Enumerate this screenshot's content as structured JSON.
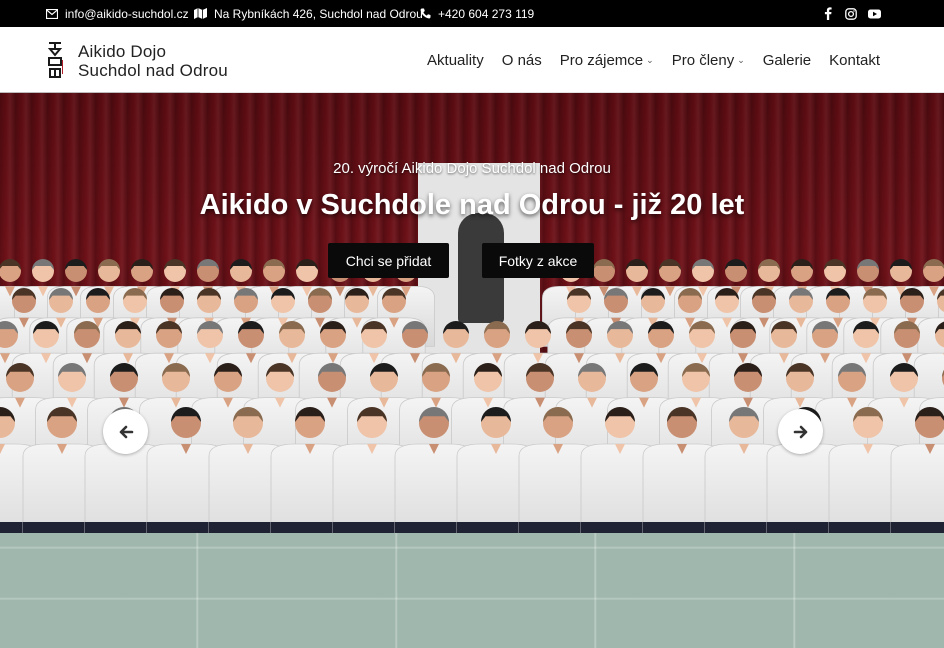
{
  "topbar": {
    "email": "info@aikido-suchdol.cz",
    "address": "Na Rybníkách 426, Suchdol nad Odrou",
    "phone": "+420 604 273 119",
    "social": [
      {
        "icon": "facebook-icon",
        "glyph": "f"
      },
      {
        "icon": "instagram-icon",
        "glyph": "◎"
      },
      {
        "icon": "youtube-icon",
        "glyph": "▶"
      }
    ]
  },
  "header": {
    "logo_line1": "Aikido Dojo",
    "logo_line2": "Suchdol nad Odrou",
    "nav": [
      {
        "label": "Aktuality",
        "has_dropdown": false
      },
      {
        "label": "O nás",
        "has_dropdown": false
      },
      {
        "label": "Pro zájemce",
        "has_dropdown": true
      },
      {
        "label": "Pro členy",
        "has_dropdown": true
      },
      {
        "label": "Galerie",
        "has_dropdown": false
      },
      {
        "label": "Kontakt",
        "has_dropdown": false
      }
    ]
  },
  "hero": {
    "subtitle": "20. výročí Aikido Dojo Suchdol nad Odrou",
    "title": "Aikido v Suchdole nad Odrou - již 20 let",
    "button_join": "Chci se přidat",
    "button_photos": "Fotky z akce",
    "prev_icon": "arrow-left-icon",
    "next_icon": "arrow-right-icon"
  },
  "colors": {
    "topbar_bg": "#000000",
    "curtain": "#6e1118",
    "mat": "#9fb7ad",
    "button_bg": "#0a0a0a"
  }
}
